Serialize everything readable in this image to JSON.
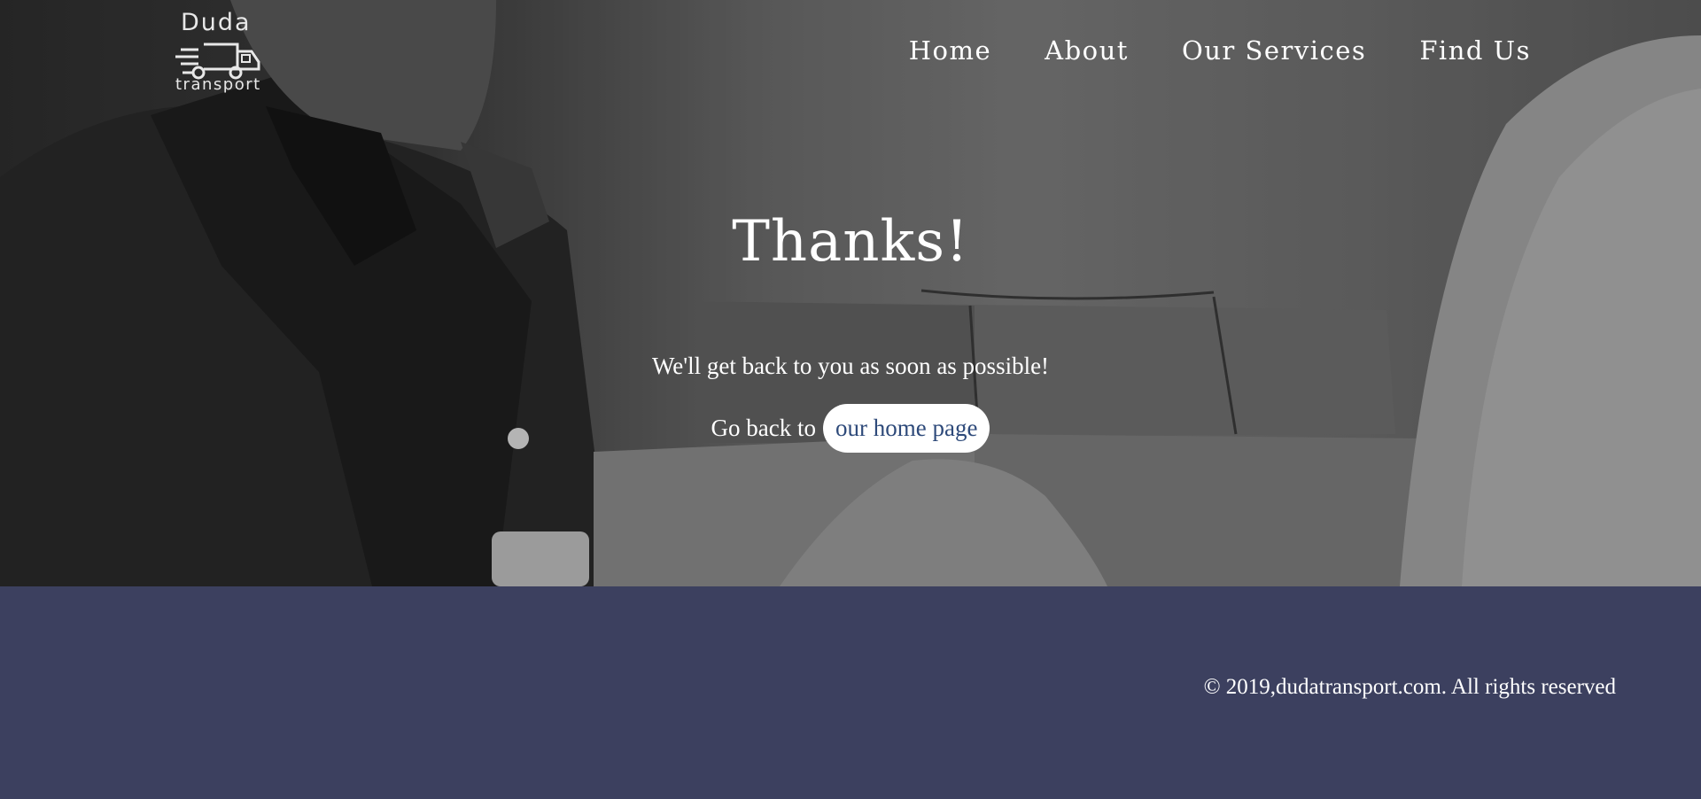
{
  "logo": {
    "word_top": "Duda",
    "word_bottom": "transport",
    "icon": "truck-icon"
  },
  "nav": {
    "items": [
      "Home",
      "About",
      "Our Services",
      "Find Us"
    ]
  },
  "hero": {
    "title": "Thanks!",
    "subtitle": "We'll get back to you as soon as possible!",
    "go_back_text": "Go back to",
    "home_link_label": "our home page"
  },
  "footer": {
    "copyright": "© 2019,dudatransport.com. All rights reserved"
  },
  "colors": {
    "footer_bg": "#3c405f",
    "link_text": "#2e4a7a",
    "text": "#ffffff"
  }
}
